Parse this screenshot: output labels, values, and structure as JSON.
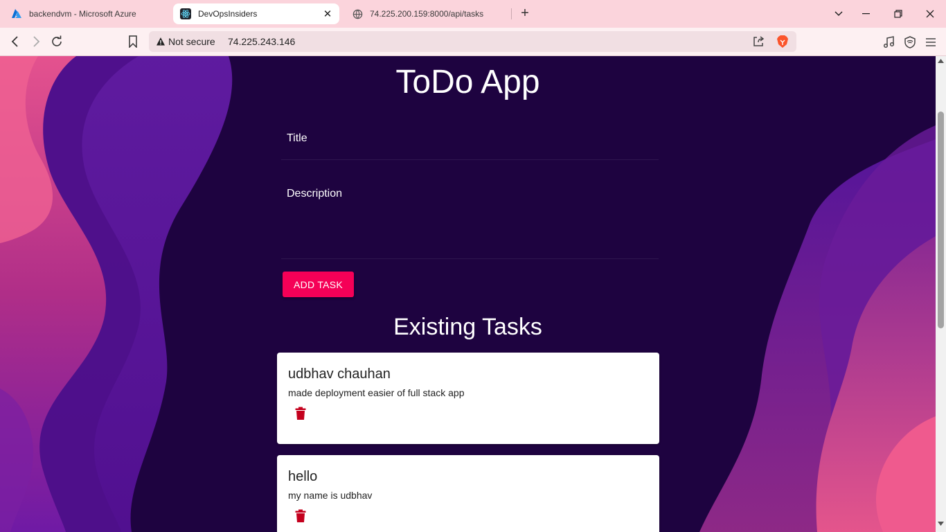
{
  "browser": {
    "tabs": [
      {
        "label": "backendvm - Microsoft Azure",
        "icon": "azure-icon"
      },
      {
        "label": "DevOpsInsiders",
        "icon": "react-icon",
        "active": true
      },
      {
        "label": "74.225.200.159:8000/api/tasks",
        "icon": "globe-icon"
      }
    ],
    "address": {
      "security_label": "Not secure",
      "url": "74.225.243.146"
    }
  },
  "app": {
    "title": "ToDo App",
    "form": {
      "title_label": "Title",
      "description_label": "Description",
      "add_button": "ADD TASK"
    },
    "tasks_heading": "Existing Tasks",
    "tasks": [
      {
        "title": "udbhav chauhan",
        "description": "made deployment easier of full stack app"
      },
      {
        "title": "hello",
        "description": "my name is udbhav"
      }
    ]
  },
  "colors": {
    "page_bg": "#1e0340",
    "accent_button": "#f50057",
    "trash_icon": "#c4001d",
    "tab_strip": "#fbd4dc"
  }
}
